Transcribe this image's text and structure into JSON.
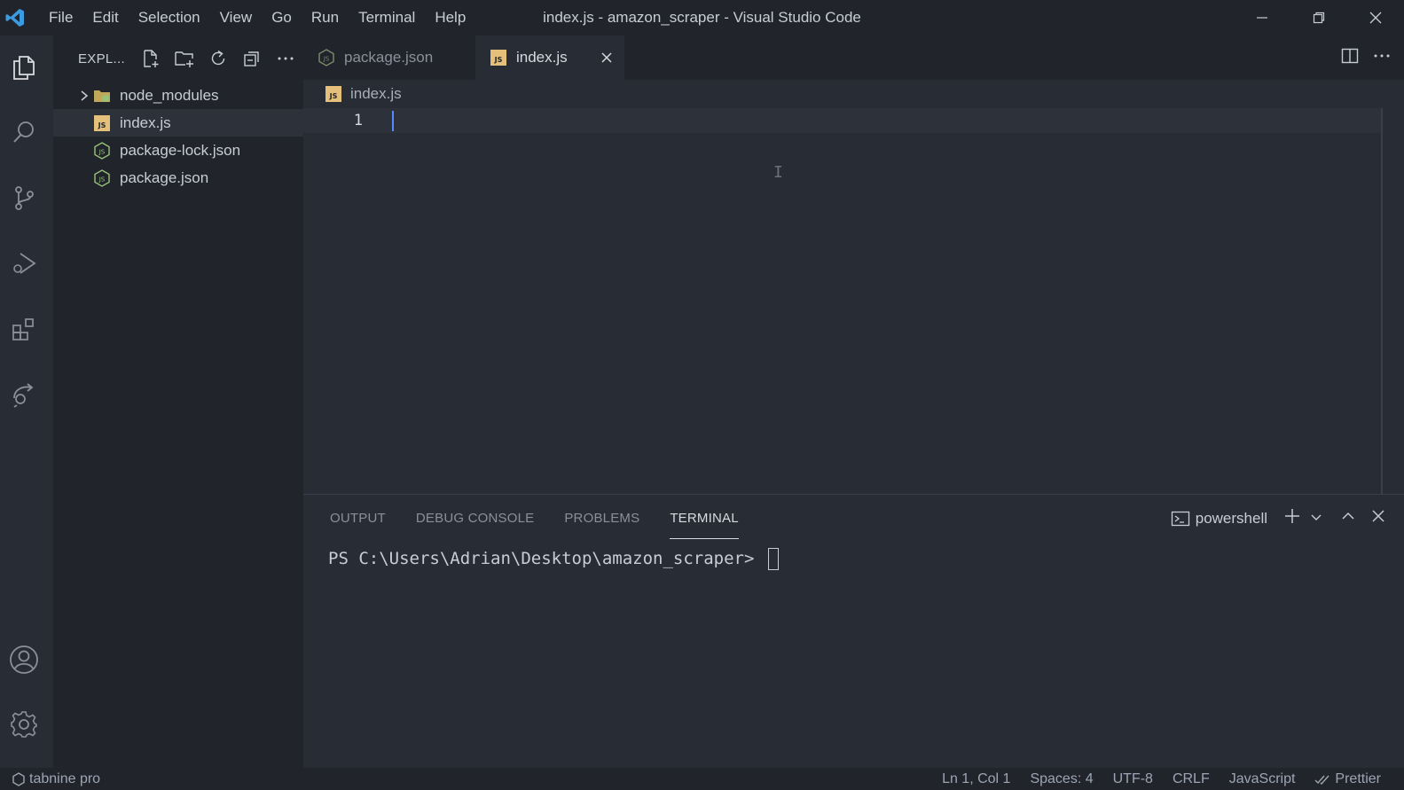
{
  "window": {
    "title": "index.js - amazon_scraper - Visual Studio Code",
    "app_icon": "vscode-logo-icon"
  },
  "menu": [
    {
      "label": "File"
    },
    {
      "label": "Edit"
    },
    {
      "label": "Selection"
    },
    {
      "label": "View"
    },
    {
      "label": "Go"
    },
    {
      "label": "Run"
    },
    {
      "label": "Terminal"
    },
    {
      "label": "Help"
    }
  ],
  "activity_bar": {
    "items": [
      "explorer-icon",
      "search-icon",
      "source-control-icon",
      "run-debug-icon",
      "extensions-icon",
      "remote-explorer-icon"
    ],
    "bottom": [
      "account-icon",
      "settings-gear-icon"
    ]
  },
  "explorer": {
    "title": "EXPL...",
    "items": [
      {
        "label": "node_modules",
        "type": "folder"
      },
      {
        "label": "index.js",
        "type": "js",
        "selected": true
      },
      {
        "label": "package-lock.json",
        "type": "json"
      },
      {
        "label": "package.json",
        "type": "json"
      }
    ]
  },
  "tabs": [
    {
      "label": "package.json",
      "active": false
    },
    {
      "label": "index.js",
      "active": true
    }
  ],
  "editor": {
    "breadcrumb": "index.js",
    "line_number": "1"
  },
  "panel": {
    "tabs": [
      "OUTPUT",
      "DEBUG CONSOLE",
      "PROBLEMS",
      "TERMINAL"
    ],
    "active_tab": "TERMINAL",
    "shell": "powershell",
    "prompt": "PS C:\\Users\\Adrian\\Desktop\\amazon_scraper> "
  },
  "statusbar": {
    "tabnine": "tabnine pro",
    "position": "Ln 1, Col 1",
    "spaces": "Spaces: 4",
    "encoding": "UTF-8",
    "eol": "CRLF",
    "language": "JavaScript",
    "formatter": "Prettier"
  },
  "colors": {
    "editor_bg": "#282c34",
    "sidebar_bg": "#21252b",
    "accent_cursor": "#528bff",
    "js_icon": "#e5c07b",
    "json_icon": "#98c379"
  }
}
